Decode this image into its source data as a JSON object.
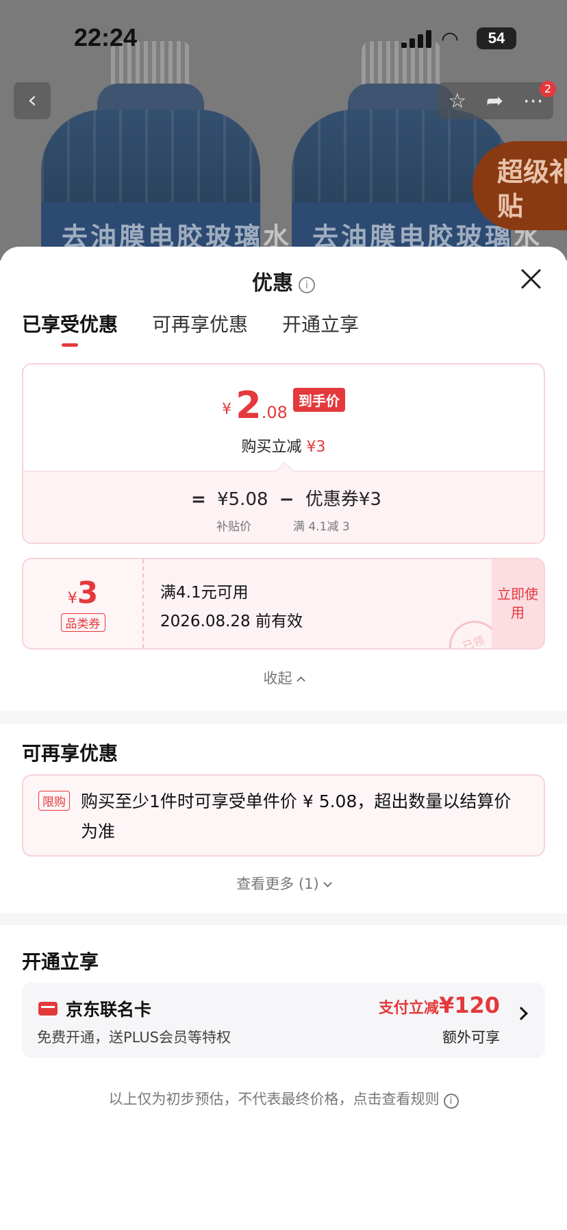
{
  "status_bar": {
    "time": "22:24",
    "battery": "54"
  },
  "background": {
    "bottle_label": "去油膜电胶玻璃水",
    "super_subsidy": "超级补贴",
    "cart_badge": "2"
  },
  "sheet": {
    "title": "优惠",
    "tabs": [
      "已享受优惠",
      "可再享优惠",
      "开通立享"
    ],
    "price": {
      "currency": "¥",
      "integer": "2",
      "decimal": ".08",
      "tag": "到手价",
      "sub_label": "购买立减",
      "sub_value": "¥3",
      "formula_eq": "=",
      "base": "¥5.08",
      "minus": "−",
      "coupon_part": "优惠券¥3",
      "base_note": "补贴价",
      "coupon_note": "满 4.1减 3"
    },
    "coupon": {
      "currency": "¥",
      "amount": "3",
      "type": "品类券",
      "condition": "满4.1元可用",
      "expiry": "2026.08.28 前有效",
      "action": "立即使用",
      "stamp": "已领"
    },
    "collapse_label": "收起",
    "more_offers": {
      "title": "可再享优惠",
      "tag": "限购",
      "text": "购买至少1件时可享受单件价 ¥ 5.08，超出数量以结算价为准",
      "more_label": "查看更多 (1)"
    },
    "open_benefits": {
      "title": "开通立享",
      "card_name": "京东联名卡",
      "card_desc": "免费开通，送PLUS会员等特权",
      "promo_prefix": "支付立减",
      "promo_amount": "¥120",
      "promo_extra": "额外可享"
    },
    "disclaimer": "以上仅为初步预估，不代表最终价格，点击查看规则"
  }
}
